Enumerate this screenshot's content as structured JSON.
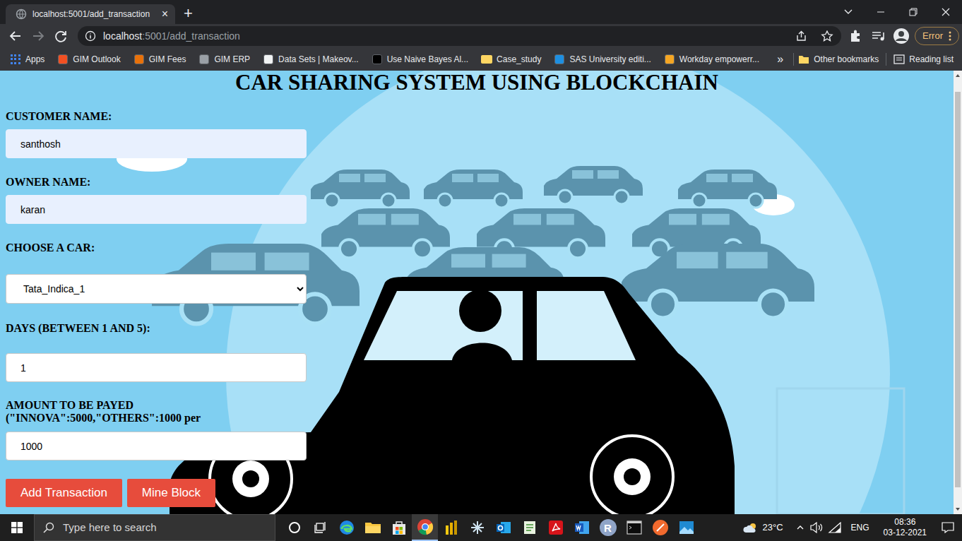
{
  "browser": {
    "tabs": [
      {
        "title": "localhost:5001/add_transaction",
        "close": "×",
        "selected": true
      }
    ],
    "new_tab": "+",
    "url": {
      "host": "localhost",
      "rest": ":5001/add_transaction"
    },
    "profile_status": "Error",
    "bookmarks": [
      {
        "label": "Apps",
        "kind": "apps",
        "color": "#4285f4"
      },
      {
        "label": "GIM Outlook",
        "kind": "site",
        "color": "#f25022"
      },
      {
        "label": "GIM Fees",
        "kind": "site",
        "color": "#e8710a"
      },
      {
        "label": "GIM ERP",
        "kind": "site",
        "color": "#9aa0a6"
      },
      {
        "label": "Data Sets | Makeov...",
        "kind": "site",
        "color": "#f1f3f4"
      },
      {
        "label": "Use Naive Bayes Al...",
        "kind": "site",
        "color": "#000000"
      },
      {
        "label": "Case_study",
        "kind": "folder",
        "color": "#fdd663"
      },
      {
        "label": "SAS University editi...",
        "kind": "site",
        "color": "#1d8fe1"
      },
      {
        "label": "Workday empowerr...",
        "kind": "site",
        "color": "#f5a623"
      }
    ],
    "bookmarks_overflow": "»",
    "other_bookmarks": "Other bookmarks",
    "reading_list": "Reading list"
  },
  "page": {
    "heading": "CAR SHARING SYSTEM USING BLOCKCHAIN",
    "fields": [
      {
        "label": "CUSTOMER NAME:",
        "kind": "text",
        "value": "santhosh",
        "autofilled": true
      },
      {
        "label": "OWNER NAME:",
        "kind": "text",
        "value": "karan",
        "autofilled": true
      },
      {
        "label": "CHOOSE A CAR:",
        "kind": "select",
        "value": "Tata_Indica_1",
        "autofilled": false
      },
      {
        "label": "DAYS (BETWEEN 1 AND 5):",
        "kind": "text",
        "value": "1",
        "autofilled": false
      },
      {
        "label": "AMOUNT TO BE PAYED (\"INNOVA\":5000,\"OTHERS\":1000 per",
        "kind": "text",
        "value": "1000",
        "autofilled": false
      }
    ],
    "buttons": [
      "Add Transaction",
      "Mine Block"
    ]
  },
  "taskbar": {
    "search_placeholder": "Type here to search",
    "r_app": "R",
    "weather": "23°C",
    "language": "ENG",
    "time": "08:36",
    "date": "03-12-2021"
  }
}
